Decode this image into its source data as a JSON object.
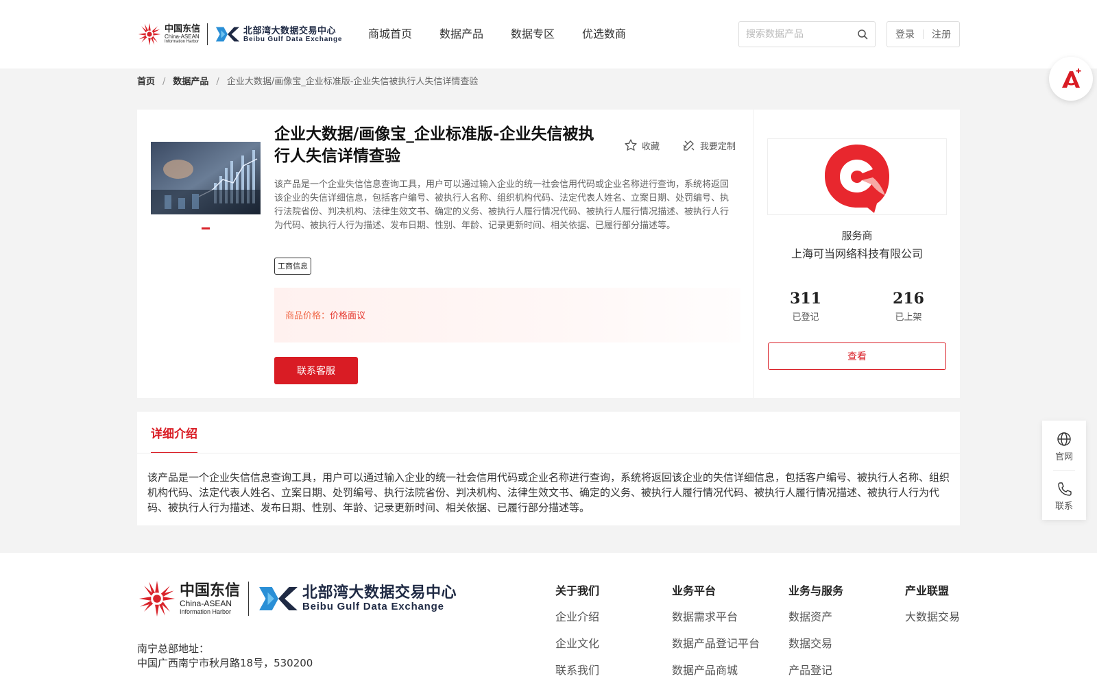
{
  "header": {
    "cn_logo": {
      "line1": "中国东信",
      "line2": "China-ASEAN",
      "line3": "Information Harbor"
    },
    "bg_logo": {
      "line1": "北部湾大数据交易中心",
      "line2": "Beibu Gulf Data Exchange"
    },
    "nav": [
      "商城首页",
      "数据产品",
      "数据专区",
      "优选数商"
    ],
    "search_placeholder": "搜索数据产品",
    "login": "登录",
    "register": "注册"
  },
  "breadcrumb": {
    "home": "首页",
    "category": "数据产品",
    "current": "企业大数据/画像宝_企业标准版-企业失信被执行人失信详情查验"
  },
  "product": {
    "title": "企业大数据/画像宝_企业标准版-企业失信被执行人失信详情查验",
    "favorite": "收藏",
    "customize": "我要定制",
    "description": "该产品是一个企业失信信息查询工具，用户可以通过输入企业的统一社会信用代码或企业名称进行查询，系统将返回该企业的失信详细信息，包括客户编号、被执行人名称、组织机构代码、法定代表人姓名、立案日期、处罚编号、执行法院省份、判决机构、法律生效文书、确定的义务、被执行人履行情况代码、被执行人履行情况描述、被执行人行为代码、被执行人行为描述、发布日期、性别、年龄、记录更新时间、相关依据、已履行部分描述等。",
    "tag": "工商信息",
    "price_label": "商品价格：",
    "price_value": "价格面议",
    "contact_button": "联系客服"
  },
  "provider": {
    "label": "服务商",
    "name": "上海可当网络科技有限公司",
    "registered_count": "311",
    "registered_label": "已登记",
    "listed_count": "216",
    "listed_label": "已上架",
    "view_button": "查看"
  },
  "detail": {
    "tab": "详细介绍",
    "text": "该产品是一个企业失信信息查询工具，用户可以通过输入企业的统一社会信用代码或企业名称进行查询，系统将返回该企业的失信详细信息，包括客户编号、被执行人名称、组织机构代码、法定代表人姓名、立案日期、处罚编号、执行法院省份、判决机构、法律生效文书、确定的义务、被执行人履行情况代码、被执行人履行情况描述、被执行人行为代码、被执行人行为描述、发布日期、性别、年龄、记录更新时间、相关依据、已履行部分描述等。"
  },
  "side_float": {
    "official": "官网",
    "contact": "联系"
  },
  "footer": {
    "address_label": "南宁总部地址：",
    "address": "中国广西南宁市秋月路18号，530200",
    "columns": [
      {
        "title": "关于我们",
        "items": [
          "企业介绍",
          "企业文化",
          "联系我们"
        ]
      },
      {
        "title": "业务平台",
        "items": [
          "数据需求平台",
          "数据产品登记平台",
          "数据产品商城"
        ]
      },
      {
        "title": "业务与服务",
        "items": [
          "数据资产",
          "数据交易",
          "产品登记"
        ]
      },
      {
        "title": "产业联盟",
        "items": [
          "大数据交易"
        ]
      }
    ]
  },
  "colors": {
    "brand_red": "#d91c24",
    "price_orange": "#f06a4a",
    "page_bg": "#f3f3f3"
  }
}
